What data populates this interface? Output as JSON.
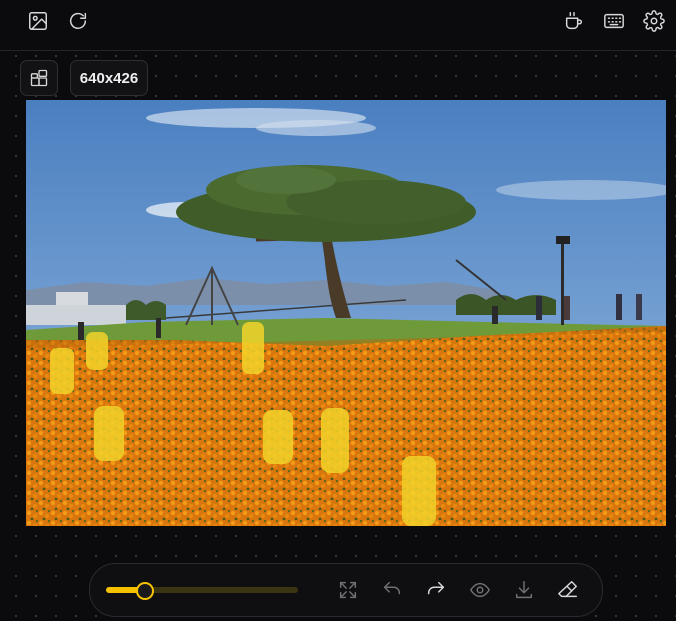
{
  "topbar": {
    "left_icons": [
      "image-icon",
      "refresh-icon"
    ],
    "right_icons": [
      "coffee-icon",
      "keyboard-icon",
      "settings-icon"
    ]
  },
  "canvas_header": {
    "layout_icon": "layout-icon",
    "size_label": "640x426"
  },
  "colors": {
    "accent": "#f6c200",
    "mask": "#f2d32a",
    "background": "#0b0b0d"
  },
  "toolbar": {
    "brush_size_fraction": 0.2,
    "tools": [
      "fullscreen-icon",
      "undo-icon",
      "redo-icon",
      "eye-icon",
      "download-icon",
      "eraser-icon"
    ]
  }
}
